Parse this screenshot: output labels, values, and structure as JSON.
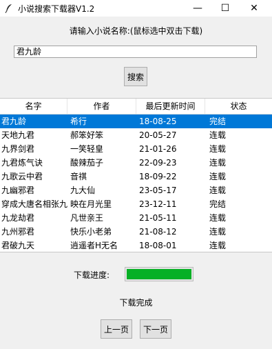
{
  "window": {
    "title": "小说搜索下载器V1.2",
    "icon": "feather-icon",
    "minimize": "—",
    "maximize": "☐",
    "close": "✕"
  },
  "search": {
    "prompt": "请输入小说名称:(鼠标选中双击下载)",
    "value": "君九龄",
    "button_label": "搜索"
  },
  "table": {
    "headers": [
      "名字",
      "作者",
      "最后更新时间",
      "状态"
    ],
    "rows": [
      [
        "君九龄",
        "希行",
        "18-08-25",
        "完结"
      ],
      [
        "天地九君",
        "郝笨好笨",
        "20-05-27",
        "连载"
      ],
      [
        "九界剑君",
        "一笑轻皇",
        "21-01-26",
        "连载"
      ],
      [
        "九君炼气诀",
        "酸辣茄子",
        "22-09-23",
        "连载"
      ],
      [
        "九歌云中君",
        "音祺",
        "18-09-22",
        "连载"
      ],
      [
        "九幽邪君",
        "九大仙",
        "23-05-17",
        "连载"
      ],
      [
        "穿成大唐名相张九龄",
        "映在月光里",
        "23-12-11",
        "完结"
      ],
      [
        "九龙劫君",
        "凡世亲王",
        "21-05-11",
        "连载"
      ],
      [
        "九州邪君",
        "快乐小老弟",
        "21-08-12",
        "连载"
      ],
      [
        "君破九天",
        "逍遥者H无名",
        "18-08-01",
        "连载"
      ]
    ],
    "selected_index": 0,
    "selection_color": "#0078d7"
  },
  "progress": {
    "label": "下载进度:",
    "value": 1.0,
    "color": "#06b025"
  },
  "status": "下载完成",
  "pagination": {
    "prev_label": "上一页",
    "next_label": "下一页"
  }
}
